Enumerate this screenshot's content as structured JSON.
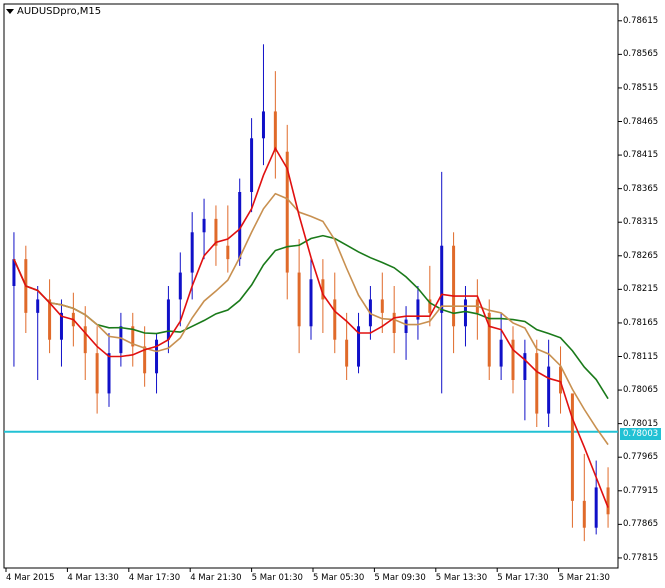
{
  "symbol": {
    "label": "AUDUSDpro,M15"
  },
  "colors": {
    "bull": "#1010c8",
    "bear": "#e06a2a",
    "ma_fast": "#e01010",
    "ma_mid": "#c89050",
    "ma_slow": "#1a7a1a",
    "hline": "#22c1d4"
  },
  "current_price": "0.78003",
  "price_axis": [
    "0.78615",
    "0.78565",
    "0.78515",
    "0.78465",
    "0.78415",
    "0.78365",
    "0.78315",
    "0.78265",
    "0.78215",
    "0.78165",
    "0.78115",
    "0.78065",
    "0.78015",
    "0.77965",
    "0.77915",
    "0.77865",
    "0.77815"
  ],
  "time_axis": [
    "4 Mar 2015",
    "4 Mar 13:30",
    "4 Mar 17:30",
    "4 Mar 21:30",
    "5 Mar 01:30",
    "5 Mar 05:30",
    "5 Mar 09:30",
    "5 Mar 13:30",
    "5 Mar 17:30",
    "5 Mar 21:30"
  ],
  "chart_data": {
    "type": "candlestick",
    "ylim": [
      0.778,
      0.7864
    ],
    "horizontal_line": 0.78003,
    "ohlc": [
      [
        0.7822,
        0.783,
        0.781,
        0.7826
      ],
      [
        0.7826,
        0.7828,
        0.7815,
        0.7818
      ],
      [
        0.7818,
        0.7822,
        0.7808,
        0.782
      ],
      [
        0.782,
        0.7823,
        0.7812,
        0.7814
      ],
      [
        0.7814,
        0.782,
        0.781,
        0.7818
      ],
      [
        0.7818,
        0.7821,
        0.7813,
        0.7816
      ],
      [
        0.7816,
        0.7819,
        0.7808,
        0.7812
      ],
      [
        0.7812,
        0.7816,
        0.7803,
        0.7806
      ],
      [
        0.7806,
        0.7815,
        0.7804,
        0.7812
      ],
      [
        0.7812,
        0.7818,
        0.781,
        0.7816
      ],
      [
        0.7816,
        0.7818,
        0.781,
        0.7813
      ],
      [
        0.7813,
        0.7816,
        0.7807,
        0.7809
      ],
      [
        0.7809,
        0.7815,
        0.7806,
        0.7814
      ],
      [
        0.7814,
        0.7822,
        0.7812,
        0.782
      ],
      [
        0.782,
        0.7827,
        0.7816,
        0.7824
      ],
      [
        0.7824,
        0.7833,
        0.782,
        0.783
      ],
      [
        0.783,
        0.7835,
        0.7826,
        0.7832
      ],
      [
        0.7832,
        0.7834,
        0.7825,
        0.7828
      ],
      [
        0.7828,
        0.7834,
        0.7824,
        0.7826
      ],
      [
        0.7826,
        0.7838,
        0.7825,
        0.7836
      ],
      [
        0.7836,
        0.7847,
        0.7833,
        0.7844
      ],
      [
        0.7844,
        0.7858,
        0.784,
        0.7848
      ],
      [
        0.7848,
        0.7854,
        0.7838,
        0.7842
      ],
      [
        0.7842,
        0.7846,
        0.782,
        0.7824
      ],
      [
        0.7824,
        0.7829,
        0.7812,
        0.7816
      ],
      [
        0.7816,
        0.7826,
        0.7814,
        0.7823
      ],
      [
        0.7823,
        0.7826,
        0.7815,
        0.782
      ],
      [
        0.782,
        0.7824,
        0.7812,
        0.7814
      ],
      [
        0.7814,
        0.7818,
        0.7808,
        0.781
      ],
      [
        0.781,
        0.7818,
        0.7809,
        0.7816
      ],
      [
        0.7816,
        0.7822,
        0.7814,
        0.782
      ],
      [
        0.782,
        0.7824,
        0.7815,
        0.7818
      ],
      [
        0.7818,
        0.7822,
        0.7812,
        0.7815
      ],
      [
        0.7815,
        0.7819,
        0.7811,
        0.7817
      ],
      [
        0.7817,
        0.7822,
        0.7814,
        0.782
      ],
      [
        0.782,
        0.7825,
        0.7816,
        0.7818
      ],
      [
        0.7818,
        0.7839,
        0.7806,
        0.7828
      ],
      [
        0.7828,
        0.783,
        0.7812,
        0.7816
      ],
      [
        0.7816,
        0.7822,
        0.7813,
        0.782
      ],
      [
        0.782,
        0.7823,
        0.7814,
        0.7818
      ],
      [
        0.7818,
        0.782,
        0.7808,
        0.781
      ],
      [
        0.781,
        0.7818,
        0.7808,
        0.7814
      ],
      [
        0.7814,
        0.7816,
        0.7806,
        0.7808
      ],
      [
        0.7808,
        0.7814,
        0.7802,
        0.7812
      ],
      [
        0.7812,
        0.7814,
        0.7801,
        0.7803
      ],
      [
        0.7803,
        0.7814,
        0.7801,
        0.781
      ],
      [
        0.781,
        0.7813,
        0.7803,
        0.7806
      ],
      [
        0.7806,
        0.7798,
        0.7786,
        0.779
      ],
      [
        0.779,
        0.7797,
        0.7784,
        0.7786
      ],
      [
        0.7786,
        0.7796,
        0.7785,
        0.7792
      ],
      [
        0.7792,
        0.7795,
        0.7786,
        0.7788
      ]
    ]
  }
}
